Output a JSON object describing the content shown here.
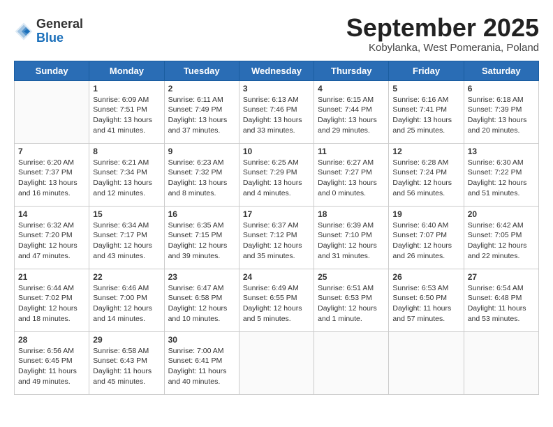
{
  "header": {
    "logo_line1": "General",
    "logo_line2": "Blue",
    "month_title": "September 2025",
    "location": "Kobylanka, West Pomerania, Poland"
  },
  "days_of_week": [
    "Sunday",
    "Monday",
    "Tuesday",
    "Wednesday",
    "Thursday",
    "Friday",
    "Saturday"
  ],
  "weeks": [
    [
      {
        "day": "",
        "info": ""
      },
      {
        "day": "1",
        "info": "Sunrise: 6:09 AM\nSunset: 7:51 PM\nDaylight: 13 hours\nand 41 minutes."
      },
      {
        "day": "2",
        "info": "Sunrise: 6:11 AM\nSunset: 7:49 PM\nDaylight: 13 hours\nand 37 minutes."
      },
      {
        "day": "3",
        "info": "Sunrise: 6:13 AM\nSunset: 7:46 PM\nDaylight: 13 hours\nand 33 minutes."
      },
      {
        "day": "4",
        "info": "Sunrise: 6:15 AM\nSunset: 7:44 PM\nDaylight: 13 hours\nand 29 minutes."
      },
      {
        "day": "5",
        "info": "Sunrise: 6:16 AM\nSunset: 7:41 PM\nDaylight: 13 hours\nand 25 minutes."
      },
      {
        "day": "6",
        "info": "Sunrise: 6:18 AM\nSunset: 7:39 PM\nDaylight: 13 hours\nand 20 minutes."
      }
    ],
    [
      {
        "day": "7",
        "info": "Sunrise: 6:20 AM\nSunset: 7:37 PM\nDaylight: 13 hours\nand 16 minutes."
      },
      {
        "day": "8",
        "info": "Sunrise: 6:21 AM\nSunset: 7:34 PM\nDaylight: 13 hours\nand 12 minutes."
      },
      {
        "day": "9",
        "info": "Sunrise: 6:23 AM\nSunset: 7:32 PM\nDaylight: 13 hours\nand 8 minutes."
      },
      {
        "day": "10",
        "info": "Sunrise: 6:25 AM\nSunset: 7:29 PM\nDaylight: 13 hours\nand 4 minutes."
      },
      {
        "day": "11",
        "info": "Sunrise: 6:27 AM\nSunset: 7:27 PM\nDaylight: 13 hours\nand 0 minutes."
      },
      {
        "day": "12",
        "info": "Sunrise: 6:28 AM\nSunset: 7:24 PM\nDaylight: 12 hours\nand 56 minutes."
      },
      {
        "day": "13",
        "info": "Sunrise: 6:30 AM\nSunset: 7:22 PM\nDaylight: 12 hours\nand 51 minutes."
      }
    ],
    [
      {
        "day": "14",
        "info": "Sunrise: 6:32 AM\nSunset: 7:20 PM\nDaylight: 12 hours\nand 47 minutes."
      },
      {
        "day": "15",
        "info": "Sunrise: 6:34 AM\nSunset: 7:17 PM\nDaylight: 12 hours\nand 43 minutes."
      },
      {
        "day": "16",
        "info": "Sunrise: 6:35 AM\nSunset: 7:15 PM\nDaylight: 12 hours\nand 39 minutes."
      },
      {
        "day": "17",
        "info": "Sunrise: 6:37 AM\nSunset: 7:12 PM\nDaylight: 12 hours\nand 35 minutes."
      },
      {
        "day": "18",
        "info": "Sunrise: 6:39 AM\nSunset: 7:10 PM\nDaylight: 12 hours\nand 31 minutes."
      },
      {
        "day": "19",
        "info": "Sunrise: 6:40 AM\nSunset: 7:07 PM\nDaylight: 12 hours\nand 26 minutes."
      },
      {
        "day": "20",
        "info": "Sunrise: 6:42 AM\nSunset: 7:05 PM\nDaylight: 12 hours\nand 22 minutes."
      }
    ],
    [
      {
        "day": "21",
        "info": "Sunrise: 6:44 AM\nSunset: 7:02 PM\nDaylight: 12 hours\nand 18 minutes."
      },
      {
        "day": "22",
        "info": "Sunrise: 6:46 AM\nSunset: 7:00 PM\nDaylight: 12 hours\nand 14 minutes."
      },
      {
        "day": "23",
        "info": "Sunrise: 6:47 AM\nSunset: 6:58 PM\nDaylight: 12 hours\nand 10 minutes."
      },
      {
        "day": "24",
        "info": "Sunrise: 6:49 AM\nSunset: 6:55 PM\nDaylight: 12 hours\nand 5 minutes."
      },
      {
        "day": "25",
        "info": "Sunrise: 6:51 AM\nSunset: 6:53 PM\nDaylight: 12 hours\nand 1 minute."
      },
      {
        "day": "26",
        "info": "Sunrise: 6:53 AM\nSunset: 6:50 PM\nDaylight: 11 hours\nand 57 minutes."
      },
      {
        "day": "27",
        "info": "Sunrise: 6:54 AM\nSunset: 6:48 PM\nDaylight: 11 hours\nand 53 minutes."
      }
    ],
    [
      {
        "day": "28",
        "info": "Sunrise: 6:56 AM\nSunset: 6:45 PM\nDaylight: 11 hours\nand 49 minutes."
      },
      {
        "day": "29",
        "info": "Sunrise: 6:58 AM\nSunset: 6:43 PM\nDaylight: 11 hours\nand 45 minutes."
      },
      {
        "day": "30",
        "info": "Sunrise: 7:00 AM\nSunset: 6:41 PM\nDaylight: 11 hours\nand 40 minutes."
      },
      {
        "day": "",
        "info": ""
      },
      {
        "day": "",
        "info": ""
      },
      {
        "day": "",
        "info": ""
      },
      {
        "day": "",
        "info": ""
      }
    ]
  ]
}
